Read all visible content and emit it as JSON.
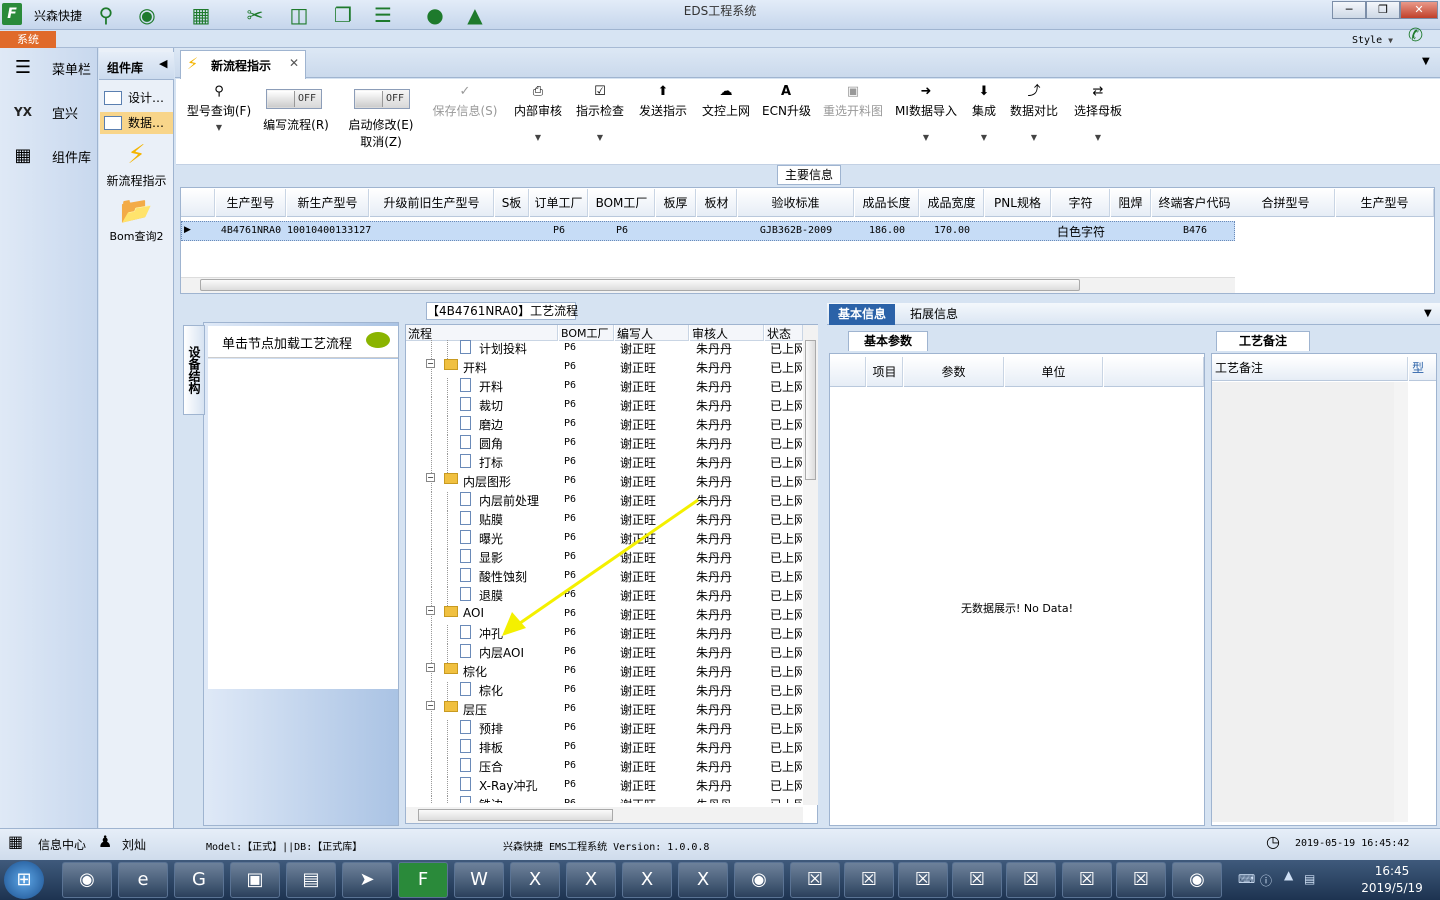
{
  "app": {
    "name": "兴森快捷",
    "window_title": "EDS工程系统",
    "system_tab": "系统",
    "style_label": "Style"
  },
  "colors": {
    "accent": "#2b62a8",
    "system_tab": "#e06a2a",
    "icon_green": "#1e7a2c"
  },
  "leftnav": {
    "items": [
      {
        "label": "菜单栏",
        "icon": "hamburger-icon"
      },
      {
        "label": "宜兴",
        "icon": "yx-factory-icon"
      },
      {
        "label": "组件库",
        "icon": "calculator-icon"
      }
    ]
  },
  "components": {
    "header": "组件库",
    "items": [
      {
        "label": "设计…"
      },
      {
        "label": "数据…"
      }
    ],
    "tools": [
      {
        "label": "新流程指示",
        "icon": "lightning-icon"
      },
      {
        "label": "Bom查询2",
        "icon": "folder-icon"
      }
    ]
  },
  "doc_tab": {
    "label": "新流程指示"
  },
  "toolbar": {
    "type_query": "型号查询(F)",
    "toggle_off": "OFF",
    "write_flow": "编写流程(R)",
    "start_modify": "启动修改(E)",
    "cancel": "取消(Z)",
    "save": "保存信息(S)",
    "internal_review": "内部审核",
    "instruct_check": "指示检查",
    "send_instruct": "发送指示",
    "doc_upload": "文控上网",
    "ecn": "ECN升级",
    "reselect": "重选开料图",
    "mi_import": "MI数据导入",
    "integrate": "集成",
    "data_compare": "数据对比",
    "select_mother": "选择母板"
  },
  "main_info": {
    "title": "主要信息",
    "columns": [
      "生产型号",
      "新生产型号",
      "升级前旧生产型号",
      "S板",
      "订单工厂",
      "BOM工厂",
      "板厚",
      "板材",
      "验收标准",
      "成品长度",
      "成品宽度",
      "PNL规格",
      "字符",
      "阻焊",
      "终端客户代码"
    ],
    "right_columns": [
      "合拼型号",
      "生产型号"
    ],
    "row": [
      "4B4761NRA0",
      "10010400133127",
      "",
      "",
      "P6",
      "P6",
      "",
      "",
      "GJB362B-2009",
      "186.00",
      "170.00",
      "",
      "白色字符",
      "",
      "B476"
    ]
  },
  "process": {
    "title": "【4B4761NRA0】工艺流程",
    "side_tab": "设备结构",
    "hint": "单击节点加载工艺流程",
    "columns": [
      "流程",
      "BOM工厂",
      "编写人",
      "审核人",
      "状态"
    ],
    "rows": [
      {
        "name": "计划投料",
        "level": 2,
        "bom": "P6",
        "writer": "谢正旺",
        "reviewer": "朱丹丹",
        "status": "已上网"
      },
      {
        "name": "开料",
        "level": 1,
        "bom": "P6",
        "writer": "谢正旺",
        "reviewer": "朱丹丹",
        "status": "已上网"
      },
      {
        "name": "开料",
        "level": 2,
        "bom": "P6",
        "writer": "谢正旺",
        "reviewer": "朱丹丹",
        "status": "已上网"
      },
      {
        "name": "裁切",
        "level": 2,
        "bom": "P6",
        "writer": "谢正旺",
        "reviewer": "朱丹丹",
        "status": "已上网"
      },
      {
        "name": "磨边",
        "level": 2,
        "bom": "P6",
        "writer": "谢正旺",
        "reviewer": "朱丹丹",
        "status": "已上网"
      },
      {
        "name": "圆角",
        "level": 2,
        "bom": "P6",
        "writer": "谢正旺",
        "reviewer": "朱丹丹",
        "status": "已上网"
      },
      {
        "name": "打标",
        "level": 2,
        "bom": "P6",
        "writer": "谢正旺",
        "reviewer": "朱丹丹",
        "status": "已上网"
      },
      {
        "name": "内层图形",
        "level": 1,
        "bom": "P6",
        "writer": "谢正旺",
        "reviewer": "朱丹丹",
        "status": "已上网"
      },
      {
        "name": "内层前处理",
        "level": 2,
        "bom": "P6",
        "writer": "谢正旺",
        "reviewer": "朱丹丹",
        "status": "已上网"
      },
      {
        "name": "贴膜",
        "level": 2,
        "bom": "P6",
        "writer": "谢正旺",
        "reviewer": "朱丹丹",
        "status": "已上网"
      },
      {
        "name": "曝光",
        "level": 2,
        "bom": "P6",
        "writer": "谢正旺",
        "reviewer": "朱丹丹",
        "status": "已上网"
      },
      {
        "name": "显影",
        "level": 2,
        "bom": "P6",
        "writer": "谢正旺",
        "reviewer": "朱丹丹",
        "status": "已上网"
      },
      {
        "name": "酸性蚀刻",
        "level": 2,
        "bom": "P6",
        "writer": "谢正旺",
        "reviewer": "朱丹丹",
        "status": "已上网"
      },
      {
        "name": "退膜",
        "level": 2,
        "bom": "P6",
        "writer": "谢正旺",
        "reviewer": "朱丹丹",
        "status": "已上网"
      },
      {
        "name": "AOI",
        "level": 1,
        "bom": "P6",
        "writer": "谢正旺",
        "reviewer": "朱丹丹",
        "status": "已上网"
      },
      {
        "name": "冲孔",
        "level": 2,
        "bom": "P6",
        "writer": "谢正旺",
        "reviewer": "朱丹丹",
        "status": "已上网"
      },
      {
        "name": "内层AOI",
        "level": 2,
        "bom": "P6",
        "writer": "谢正旺",
        "reviewer": "朱丹丹",
        "status": "已上网"
      },
      {
        "name": "棕化",
        "level": 1,
        "bom": "P6",
        "writer": "谢正旺",
        "reviewer": "朱丹丹",
        "status": "已上网"
      },
      {
        "name": "棕化",
        "level": 2,
        "bom": "P6",
        "writer": "谢正旺",
        "reviewer": "朱丹丹",
        "status": "已上网"
      },
      {
        "name": "层压",
        "level": 1,
        "bom": "P6",
        "writer": "谢正旺",
        "reviewer": "朱丹丹",
        "status": "已上网"
      },
      {
        "name": "预排",
        "level": 2,
        "bom": "P6",
        "writer": "谢正旺",
        "reviewer": "朱丹丹",
        "status": "已上网"
      },
      {
        "name": "排板",
        "level": 2,
        "bom": "P6",
        "writer": "谢正旺",
        "reviewer": "朱丹丹",
        "status": "已上网"
      },
      {
        "name": "压合",
        "level": 2,
        "bom": "P6",
        "writer": "谢正旺",
        "reviewer": "朱丹丹",
        "status": "已上网"
      },
      {
        "name": "X-Ray冲孔",
        "level": 2,
        "bom": "P6",
        "writer": "谢正旺",
        "reviewer": "朱丹丹",
        "status": "已上网"
      },
      {
        "name": "铣边",
        "level": 2,
        "bom": "P6",
        "writer": "谢正旺",
        "reviewer": "朱丹丹",
        "status": "已上网"
      }
    ]
  },
  "right_panel": {
    "tabs": [
      "基本信息",
      "拓展信息"
    ],
    "params_title": "基本参数",
    "params_columns": [
      "项目",
      "参数",
      "单位"
    ],
    "no_data": "无数据展示! No Data!",
    "notes_title": "工艺备注",
    "notes_columns": [
      "工艺备注",
      "型"
    ]
  },
  "status": {
    "info_center": "信息中心",
    "user": "刘灿",
    "model": "Model:【正式】||DB:【正式库】",
    "version": "兴森快捷 EMS工程系统 Version: 1.0.0.8",
    "datetime": "2019-05-19 16:45:42"
  },
  "taskbar": {
    "time": "16:45",
    "date": "2019/5/19"
  }
}
